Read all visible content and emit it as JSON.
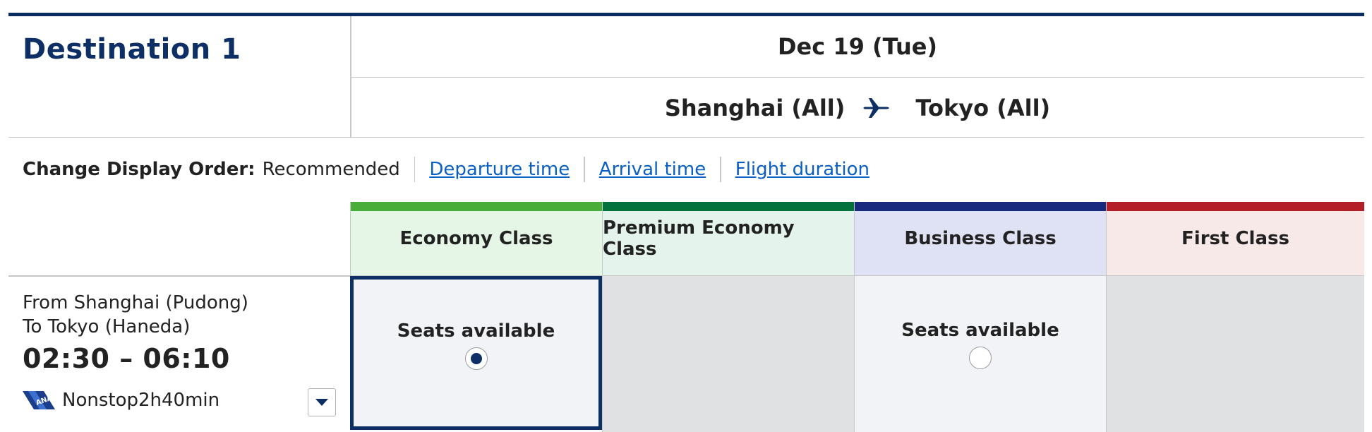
{
  "header": {
    "title": "Destination 1",
    "date": "Dec 19 (Tue)",
    "origin": "Shanghai (All)",
    "destination": "Tokyo (All)",
    "route_icon": "airplane-icon"
  },
  "sort": {
    "label": "Change Display Order:",
    "current": "Recommended",
    "options": [
      "Departure time",
      "Arrival time",
      "Flight duration"
    ]
  },
  "classes": {
    "economy": {
      "label": "Economy Class",
      "color": "#49ad3a",
      "bg": "#e5f5e6"
    },
    "premium": {
      "label": "Premium Economy Class",
      "color": "#03723d",
      "bg": "#e4f4ec"
    },
    "business": {
      "label": "Business Class",
      "color": "#172a7e",
      "bg": "#dfe1f5"
    },
    "first": {
      "label": "First Class",
      "color": "#b41f27",
      "bg": "#f8e9e9"
    }
  },
  "flight": {
    "from": "From Shanghai (Pudong)",
    "to": "To Tokyo (Haneda)",
    "times": "02:30  –  06:10",
    "nonstop": "Nonstop2h40min",
    "airline_logo": "ana-logo-icon"
  },
  "fares": {
    "economy": {
      "status": "Seats available",
      "selected": true
    },
    "premium": {
      "status": "",
      "selected": false
    },
    "business": {
      "status": "Seats available",
      "selected": false
    },
    "first": {
      "status": "",
      "selected": false
    }
  }
}
